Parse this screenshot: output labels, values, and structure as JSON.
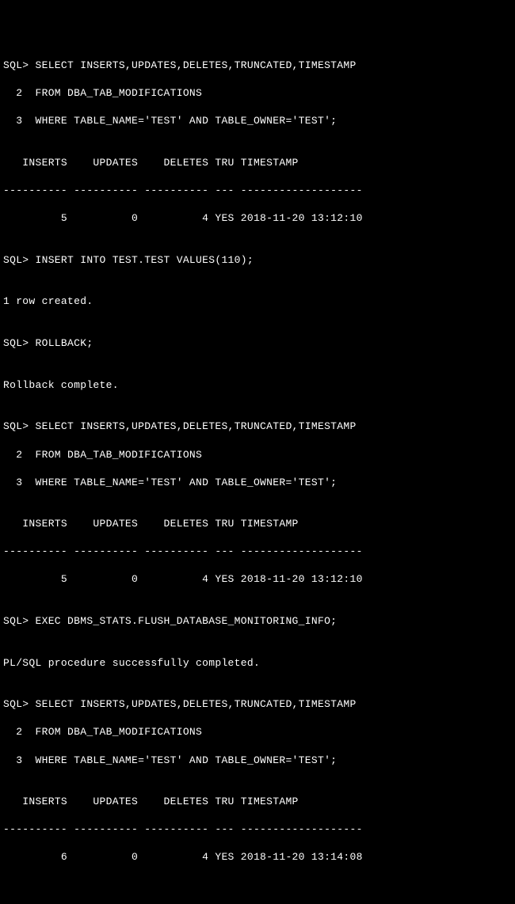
{
  "lines": {
    "l01": "SQL> SELECT INSERTS,UPDATES,DELETES,TRUNCATED,TIMESTAMP",
    "l02": "  2  FROM DBA_TAB_MODIFICATIONS",
    "l03": "  3  WHERE TABLE_NAME='TEST' AND TABLE_OWNER='TEST';",
    "l04": "",
    "l05": "   INSERTS    UPDATES    DELETES TRU TIMESTAMP",
    "l06": "---------- ---------- ---------- --- -------------------",
    "l07": "         5          0          4 YES 2018-11-20 13:12:10",
    "l08": "",
    "l09": "SQL> INSERT INTO TEST.TEST VALUES(110);",
    "l10": "",
    "l11": "1 row created.",
    "l12": "",
    "l13": "SQL> ROLLBACK;",
    "l14": "",
    "l15": "Rollback complete.",
    "l16": "",
    "l17": "SQL> SELECT INSERTS,UPDATES,DELETES,TRUNCATED,TIMESTAMP",
    "l18": "  2  FROM DBA_TAB_MODIFICATIONS",
    "l19": "  3  WHERE TABLE_NAME='TEST' AND TABLE_OWNER='TEST';",
    "l20": "",
    "l21": "   INSERTS    UPDATES    DELETES TRU TIMESTAMP",
    "l22": "---------- ---------- ---------- --- -------------------",
    "l23": "         5          0          4 YES 2018-11-20 13:12:10",
    "l24": "",
    "l25": "SQL> EXEC DBMS_STATS.FLUSH_DATABASE_MONITORING_INFO;",
    "l26": "",
    "l27": "PL/SQL procedure successfully completed.",
    "l28": "",
    "l29": "SQL> SELECT INSERTS,UPDATES,DELETES,TRUNCATED,TIMESTAMP",
    "l30": "  2  FROM DBA_TAB_MODIFICATIONS",
    "l31": "  3  WHERE TABLE_NAME='TEST' AND TABLE_OWNER='TEST';",
    "l32": "",
    "l33": "   INSERTS    UPDATES    DELETES TRU TIMESTAMP",
    "l34": "---------- ---------- ---------- --- -------------------",
    "l35": "         6          0          4 YES 2018-11-20 13:14:08"
  }
}
